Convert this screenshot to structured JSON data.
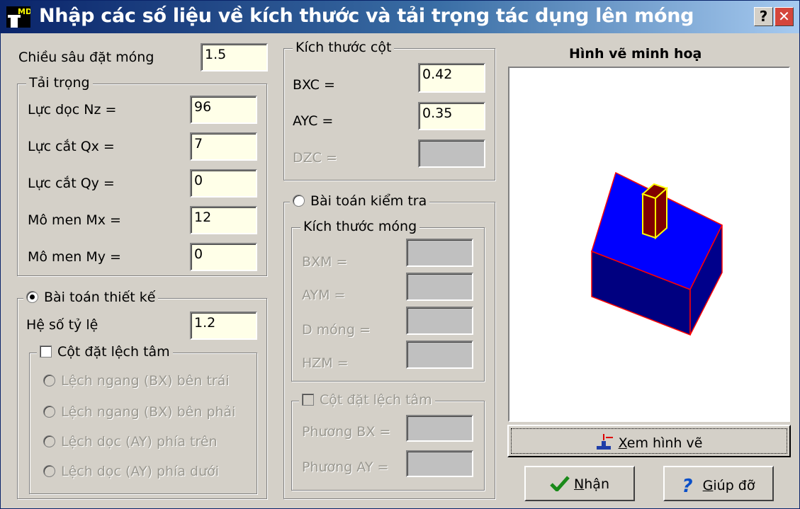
{
  "window": {
    "title": "Nhập các số liệu về kích thước và tải trọng tác dụng lên móng",
    "icon_text": "MD",
    "help_glyph": "?",
    "close_glyph": "✕"
  },
  "depth": {
    "label": "Chiều sâu đặt móng",
    "value": "1.5"
  },
  "loads": {
    "title": "Tải trọng",
    "nz": {
      "label": "Lực dọc Nz =",
      "value": "96"
    },
    "qx": {
      "label": "Lực cắt Qx =",
      "value": "7"
    },
    "qy": {
      "label": "Lực cắt Qy =",
      "value": "0"
    },
    "mx": {
      "label": "Mô men Mx =",
      "value": "12"
    },
    "my": {
      "label": "Mô men My =",
      "value": "0"
    }
  },
  "design": {
    "title": "Bài toán thiết kế",
    "selected": true,
    "ratio": {
      "label": "Hệ số tỷ lệ",
      "value": "1.2"
    },
    "eccentric": {
      "title": "Cột đặt lệch tâm",
      "checked": false,
      "options": [
        "Lệch ngang (BX) bên trái",
        "Lệch ngang (BX) bên phải",
        "Lệch dọc (AY) phía trên",
        "Lệch dọc (AY) phía dưới"
      ]
    }
  },
  "column": {
    "title": "Kích thước cột",
    "bxc": {
      "label": "BXC =",
      "value": "0.42"
    },
    "ayc": {
      "label": "AYC =",
      "value": "0.35"
    },
    "dzc": {
      "label": "DZC =",
      "value": ""
    }
  },
  "check": {
    "title": "Bài toán kiểm tra",
    "selected": false,
    "footing": {
      "title": "Kích thước móng",
      "bxm": {
        "label": "BXM =",
        "value": ""
      },
      "aym": {
        "label": "AYM =",
        "value": ""
      },
      "dmong": {
        "label": "D móng =",
        "value": ""
      },
      "hzm": {
        "label": "HZM =",
        "value": ""
      }
    },
    "eccentric": {
      "title": "Cột đặt lệch tâm",
      "bx": {
        "label": "Phương BX =",
        "value": ""
      },
      "ay": {
        "label": "Phương  AY =",
        "value": ""
      }
    }
  },
  "preview": {
    "title": "Hình vẽ minh hoạ",
    "colors": {
      "footing_top": "#0000ff",
      "footing_front": "#000080",
      "footing_side": "#00008b",
      "edge": "#ff0000",
      "column_face": "#800000",
      "column_edge": "#ffff00"
    }
  },
  "buttons": {
    "view_prefix": "",
    "view_underlined": "X",
    "view_rest": "em hình vẽ",
    "ok_underlined": "N",
    "ok_rest": "hận",
    "help_underlined": "G",
    "help_rest": "iúp đỡ"
  }
}
